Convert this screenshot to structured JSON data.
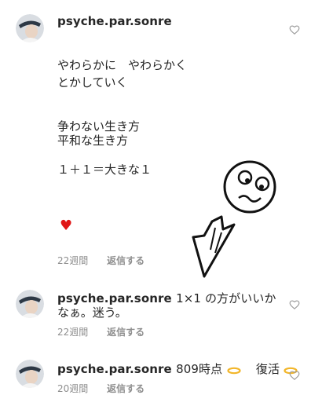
{
  "comments": [
    {
      "username": "psyche.par.sonre",
      "lines": [
        "やわらかに　やわらかく",
        "とかしていく",
        "争わない生き方",
        "平和な生き方",
        "１＋１＝大きな１"
      ],
      "emoji": "♥",
      "time": "22週間",
      "reply": "返信する",
      "like_icon": "heart-outline-icon"
    },
    {
      "username": "psyche.par.sonre",
      "text_inline": "1×1 の方がいいか",
      "text_line2": "なぁ。迷う。",
      "time": "22週間",
      "reply": "返信する",
      "like_icon": "heart-outline-icon"
    },
    {
      "username": "psyche.par.sonre",
      "text_inline_a": "809時点",
      "text_inline_b": "復活",
      "time": "20週間",
      "reply": "返信する",
      "like_icon": "heart-outline-icon"
    }
  ],
  "colors": {
    "heart_red": "#e01616",
    "meta_gray": "#8e8e8e",
    "text": "#262626"
  }
}
